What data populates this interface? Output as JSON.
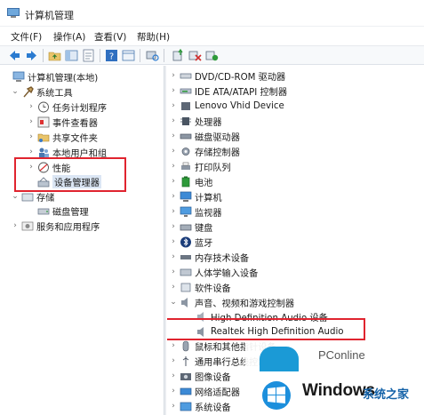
{
  "window": {
    "title": "计算机管理"
  },
  "menu": [
    "文件(F)",
    "操作(A)",
    "查看(V)",
    "帮助(H)"
  ],
  "toolbar_icons": [
    "back-arrow-icon",
    "forward-arrow-icon",
    "folder-up-icon",
    "console-tree-icon",
    "properties-icon",
    "help-icon",
    "view-icon",
    "scan-hardware-icon",
    "update-driver-icon",
    "disable-device-icon",
    "uninstall-device-icon"
  ],
  "left_tree": {
    "root": "计算机管理(本地)",
    "system_tools": "系统工具",
    "task_scheduler": "任务计划程序",
    "event_viewer": "事件查看器",
    "shared_folders": "共享文件夹",
    "local_users": "本地用户和组",
    "performance": "性能",
    "device_manager": "设备管理器",
    "storage": "存储",
    "disk_management": "磁盘管理",
    "services_apps": "服务和应用程序"
  },
  "right_tree": {
    "items": [
      "DVD/CD-ROM 驱动器",
      "IDE ATA/ATAPI 控制器",
      "Lenovo Vhid Device",
      "处理器",
      "磁盘驱动器",
      "存储控制器",
      "打印队列",
      "电池",
      "计算机",
      "监视器",
      "键盘",
      "蓝牙",
      "内存技术设备",
      "人体学输入设备",
      "软件设备",
      "声音、视频和游戏控制器",
      "High Definition Audio 设备",
      "Realtek High Definition Audio",
      "鼠标和其他指针设备",
      "通用串行总线控制器",
      "图像设备",
      "网络适配器",
      "系统设备"
    ]
  },
  "watermark": {
    "pconline": "PConline",
    "windows": "Windows",
    "site": "系统之家"
  },
  "colors": {
    "highlight": "#e0242f",
    "selection": "#dbe6f4",
    "accent": "#1b9ad6"
  }
}
